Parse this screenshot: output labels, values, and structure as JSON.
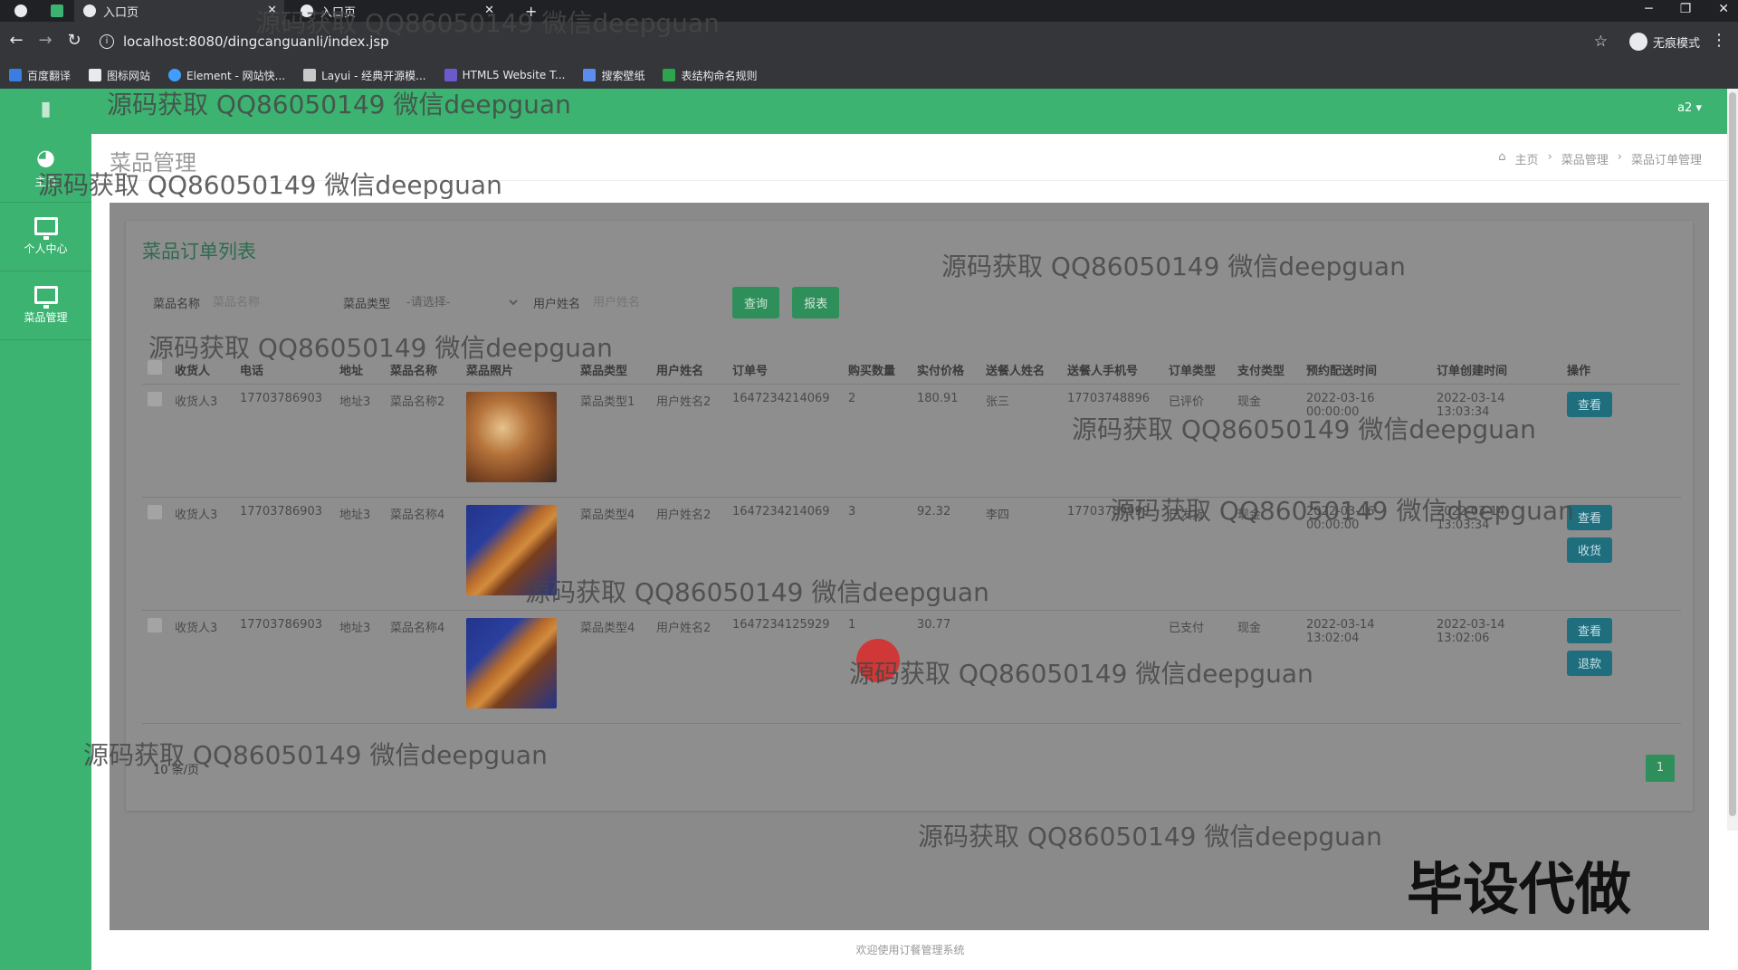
{
  "browser": {
    "tabs": [
      {
        "title": "入口页",
        "active": true
      },
      {
        "title": "入口页",
        "active": false
      }
    ],
    "new_tab": "+",
    "url": "localhost:8080/dingcanguanli/index.jsp",
    "incognito_label": "无痕模式",
    "bookmarks": [
      "百度翻译",
      "图标网站",
      "Element - 网站快...",
      "Layui - 经典开源模...",
      "HTML5 Website T...",
      "搜索壁纸",
      "表结构命名规则"
    ],
    "window_controls": {
      "minimize": "─",
      "restore": "❐",
      "close": "✕"
    }
  },
  "sidebar": {
    "items": [
      {
        "label": "主页",
        "icon": "dashboard-icon"
      },
      {
        "label": "个人中心",
        "icon": "monitor-icon"
      },
      {
        "label": "菜品管理",
        "icon": "monitor-icon"
      }
    ]
  },
  "topbar": {
    "user": "a2 ▾"
  },
  "header": {
    "page_title": "菜品管理",
    "breadcrumb": [
      "主页",
      "菜品管理",
      "菜品订单管理"
    ]
  },
  "panel": {
    "title": "菜品订单列表",
    "search": {
      "dish_name_label": "菜品名称",
      "dish_name_placeholder": "菜品名称",
      "dish_type_label": "菜品类型",
      "dish_type_selected": "-请选择-",
      "user_name_label": "用户姓名",
      "user_name_placeholder": "用户姓名",
      "query_button": "查询",
      "report_button": "报表"
    },
    "columns": [
      "收货人",
      "电话",
      "地址",
      "菜品名称",
      "菜品照片",
      "菜品类型",
      "用户姓名",
      "订单号",
      "购买数量",
      "实付价格",
      "送餐人姓名",
      "送餐人手机号",
      "订单类型",
      "支付类型",
      "预约配送时间",
      "订单创建时间",
      "操作"
    ],
    "rows": [
      {
        "receiver": "收货人3",
        "phone": "17703786903",
        "address": "地址3",
        "dish_name": "菜品名称2",
        "photo": "a",
        "dish_type": "菜品类型1",
        "user_name": "用户姓名2",
        "order_no": "1647234214069",
        "qty": "2",
        "price": "180.91",
        "courier": "张三",
        "courier_phone": "17703748896",
        "order_type": "已评价",
        "pay_type": "现金",
        "delivery_time": "2022-03-16 00:00:00",
        "created": "2022-03-14 13:03:34",
        "actions": [
          "查看"
        ]
      },
      {
        "receiver": "收货人3",
        "phone": "17703786903",
        "address": "地址3",
        "dish_name": "菜品名称4",
        "photo": "b",
        "dish_type": "菜品类型4",
        "user_name": "用户姓名2",
        "order_no": "1647234214069",
        "qty": "3",
        "price": "92.32",
        "courier": "李四",
        "courier_phone": "17703789999",
        "order_type": "已发货",
        "pay_type": "现金",
        "delivery_time": "2022-03-16 00:00:00",
        "created": "2022-03-14 13:03:34",
        "actions": [
          "查看",
          "收货"
        ]
      },
      {
        "receiver": "收货人3",
        "phone": "17703786903",
        "address": "地址3",
        "dish_name": "菜品名称4",
        "photo": "b",
        "dish_type": "菜品类型4",
        "user_name": "用户姓名2",
        "order_no": "1647234125929",
        "qty": "1",
        "price": "30.77",
        "courier": "",
        "courier_phone": "",
        "order_type": "已支付",
        "pay_type": "现金",
        "delivery_time": "2022-03-14 13:02:04",
        "created": "2022-03-14 13:02:06",
        "actions": [
          "查看",
          "退款"
        ]
      }
    ],
    "page_size": "10 条/页",
    "page_number": "1"
  },
  "footer": "欢迎使用订餐管理系统",
  "watermark_text": "源码获取 QQ86050149 微信deepguan",
  "stamp_text": "毕设代做",
  "colors": {
    "brand_green": "#3cb371",
    "button_green": "#2f8f5b",
    "action_teal": "#1e6e7e"
  }
}
